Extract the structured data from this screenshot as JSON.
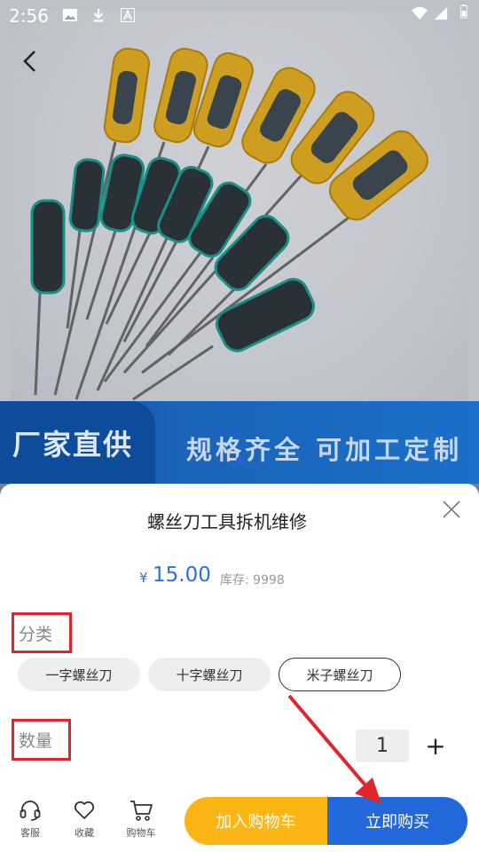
{
  "status_bar": {
    "time": "2:56"
  },
  "banner": {
    "left_text": "厂家直供",
    "right_text": "规格齐全 可加工定制"
  },
  "product": {
    "title": "螺丝刀工具拆机维修",
    "currency_symbol": "¥",
    "price": "15.00",
    "stock_text": "库存: 9998"
  },
  "category": {
    "label": "分类",
    "options": [
      {
        "label": "一字螺丝刀",
        "selected": false
      },
      {
        "label": "十字螺丝刀",
        "selected": false
      },
      {
        "label": "米子螺丝刀",
        "selected": true
      }
    ]
  },
  "quantity": {
    "label": "数量",
    "value": "1",
    "plus": "+"
  },
  "bottom_nav": [
    {
      "label": "客服",
      "icon": "headset-icon"
    },
    {
      "label": "收藏",
      "icon": "heart-icon"
    },
    {
      "label": "购物车",
      "icon": "cart-icon"
    }
  ],
  "actions": {
    "add_to_cart": "加入购物车",
    "buy_now": "立即购买"
  },
  "colors": {
    "accent_blue": "#2268da",
    "accent_yellow": "#fbb615",
    "highlight_red": "#e0262a",
    "price_blue": "#2f6fd8"
  }
}
